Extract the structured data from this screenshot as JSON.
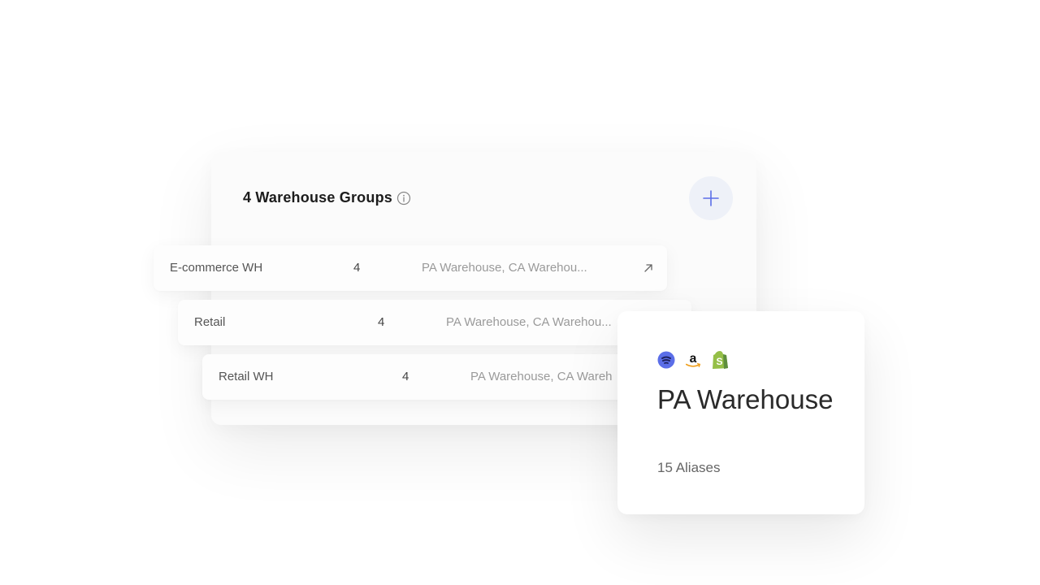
{
  "groups_panel": {
    "title": "4 Warehouse Groups",
    "add_icon": "plus-icon",
    "info_icon": "info-icon"
  },
  "rows": [
    {
      "name": "E-commerce WH",
      "count": "4",
      "warehouses": "PA Warehouse, CA Warehou...",
      "icon": "arrow-up-right-icon"
    },
    {
      "name": "Retail",
      "count": "4",
      "warehouses": "PA Warehouse, CA Warehou..."
    },
    {
      "name": "Retail WH",
      "count": "4",
      "warehouses": "PA Warehouse, CA Wareh"
    }
  ],
  "warehouse_card": {
    "title": "PA Warehouse",
    "aliases": "15 Aliases",
    "logos": [
      "blue-circle-logo",
      "amazon-logo",
      "shopify-logo"
    ]
  },
  "colors": {
    "accent": "#5b6ee8",
    "amazon_orange": "#f0a020",
    "shopify_green": "#95bf47"
  }
}
